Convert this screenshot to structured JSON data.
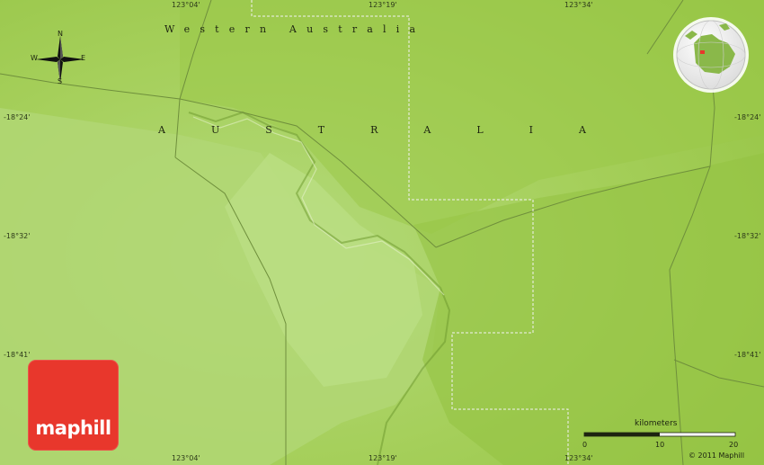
{
  "map": {
    "region_label": "Western Australia",
    "country_label": "AUSTRALIA",
    "coords": {
      "lon_top": [
        "123°04'",
        "123°19'",
        "123°34'"
      ],
      "lon_bottom": [
        "123°04'",
        "123°19'",
        "123°34'"
      ],
      "lat_left": [
        "-18°24'",
        "-18°32'",
        "-18°41'"
      ],
      "lat_right": [
        "-18°24'",
        "-18°32'",
        "-18°41'"
      ]
    },
    "compass": {
      "n": "N",
      "s": "S",
      "e": "E",
      "w": "W"
    },
    "scale": {
      "title": "kilometers",
      "ticks": [
        "0",
        "10",
        "20"
      ]
    },
    "logo_text": "maphill",
    "copyright": "© 2011 Maphill",
    "colors": {
      "land": "#9fcb4a",
      "lowland": "#b3d97a",
      "logo": "#e8372c",
      "border": "#f2f2f2",
      "road": "#6f8f3c"
    }
  }
}
